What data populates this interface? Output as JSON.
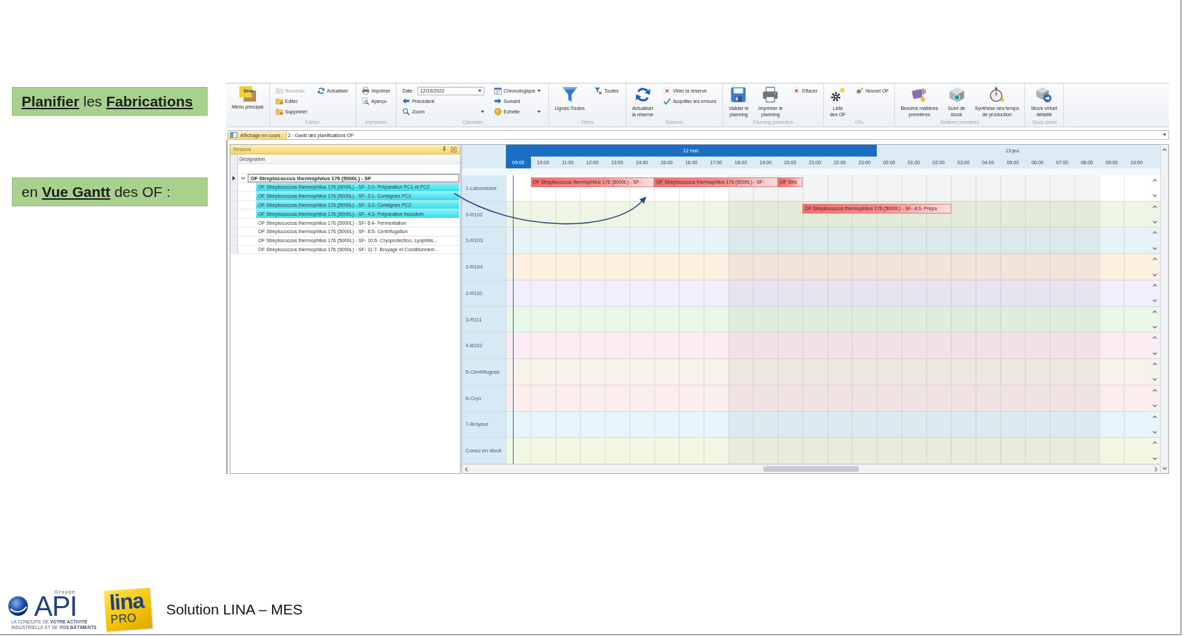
{
  "slide": {
    "headings": [
      {
        "text": "**Planifier** les **Fabrications**"
      },
      {
        "text": "en **Vue Gantt** des OF :"
      }
    ],
    "footer": {
      "api_logo": {
        "group": "Groupe",
        "name": "API",
        "tagline": "LA CONDUITE DE **VOTRE ACTIVITÉ**\nINDUSTRIELLE ET DE **VOS BÂTIMENTS**"
      },
      "lina_logo": {
        "name": "lina",
        "edition": "PRO"
      },
      "caption": "Solution LINA – MES"
    }
  },
  "app": {
    "ribbon": {
      "groups": [
        {
          "large": [
            {
              "label": "Menu principal",
              "logo_text": "lina",
              "disabled": false
            }
          ]
        },
        {
          "label": "Edition",
          "columns": [
            [
              {
                "kind": "button",
                "label": "Nouveau",
                "disabled": true
              },
              {
                "kind": "button",
                "label": "Editer",
                "disabled": false
              },
              {
                "kind": "button",
                "label": "Supprimer",
                "disabled": false
              }
            ],
            [
              {
                "kind": "button",
                "label": "Actualiser",
                "disabled": false
              }
            ]
          ]
        },
        {
          "label": "Impression",
          "columns": [
            [
              {
                "kind": "button",
                "label": "Imprimer",
                "disabled": false
              },
              {
                "kind": "button",
                "label": "Aperçu",
                "disabled": false
              }
            ]
          ]
        },
        {
          "label": "Calendrier",
          "columns": [
            [
              {
                "kind": "date",
                "label": "Date :",
                "value": "12/10/2022",
                "disabled": false
              },
              {
                "kind": "button",
                "label": "Précédent",
                "disabled": false
              },
              {
                "kind": "dropdown",
                "label": "Zoom",
                "disabled": false
              }
            ],
            [
              {
                "kind": "dropdown",
                "label": "Chronologique",
                "disabled": false
              },
              {
                "kind": "button",
                "label": "Suivant",
                "disabled": false
              },
              {
                "kind": "dropdown",
                "label": "Echelle",
                "disabled": false
              }
            ]
          ]
        },
        {
          "label": "Filtres",
          "large": [
            {
              "label": "Lignes:Toutes",
              "disabled": false
            }
          ],
          "columns": [
            [
              {
                "kind": "button",
                "label": "Toutes",
                "disabled": false
              }
            ]
          ]
        },
        {
          "label": "Réserve",
          "large": [
            {
              "label": "Actualiser\nla réserve",
              "disabled": false
            }
          ],
          "columns": [
            [
              {
                "kind": "button",
                "label": "Vider la réserve",
                "disabled": false
              },
              {
                "kind": "button",
                "label": "Acquitter les erreurs",
                "disabled": false
              }
            ]
          ]
        },
        {
          "label": "Planning production",
          "large": [
            {
              "label": "Valider le\nplanning",
              "disabled": false
            },
            {
              "label": "Imprimer le\nplanning",
              "disabled": false
            }
          ],
          "columns": [
            [
              {
                "kind": "button",
                "label": "Effacer",
                "disabled": false
              }
            ]
          ]
        },
        {
          "label": "OFs",
          "large": [
            {
              "label": "Liste\ndes OF",
              "disabled": false
            }
          ],
          "columns": [
            [
              {
                "kind": "button",
                "label": "Nouvel OF",
                "disabled": false
              }
            ]
          ]
        },
        {
          "label": "Matières premières",
          "large": [
            {
              "label": "Besoins matières\npremières",
              "disabled": false
            },
            {
              "label": "Suivi de\nstock",
              "disabled": false
            },
            {
              "label": "Synthèse des temps\nde production",
              "disabled": false
            }
          ]
        },
        {
          "label": "Stock virtuel",
          "large": [
            {
              "label": "Stock virtuel\ndétaillé",
              "disabled": false
            }
          ]
        }
      ]
    },
    "view_bar": {
      "label": "Affichage en cours :",
      "value": "2 - Gantt des planifications OF"
    },
    "reserve": {
      "title": "Réserve",
      "column": "Désignation",
      "tree": [
        {
          "label": "OF Streptococcus thermophilus 176 (5000L) - SF",
          "expanded": true,
          "focused": true,
          "children": [
            {
              "label": "OF Streptococcus thermophilus 176 (5000L) - SF- 1:0- Préparation PC1 et PC2",
              "selected": true
            },
            {
              "label": "OF Streptococcus thermophilus 176 (5000L) - SF- 2:1- Consignes PC1",
              "selected": true
            },
            {
              "label": "OF Streptococcus thermophilus 176 (5000L) - SF- 3:2- Consignes PC2",
              "selected": true
            },
            {
              "label": "OF Streptococcus thermophilus 176 (5000L) - SF- 4:3- Préparation Inoculum",
              "selected": true
            },
            {
              "label": "OF Streptococcus thermophilus 176 (5000L) - SF- 6:4- Fermentation",
              "selected": false
            },
            {
              "label": "OF Streptococcus thermophilus 176 (5000L) - SF- 8:5- Centrifugation",
              "selected": false
            },
            {
              "label": "OF Streptococcus thermophilus 176 (5000L) - SF- 10:6- Cryoprotection, Lyophilis…",
              "selected": false
            },
            {
              "label": "OF Streptococcus thermophilus 176 (5000L) - SF- 11:7- Broyage et Conditionnem…",
              "selected": false
            }
          ]
        }
      ]
    },
    "gantt": {
      "days": [
        {
          "label": "12 mer.",
          "selected": true,
          "hours": [
            {
              "label": "09:00",
              "selected": true,
              "night": false
            },
            {
              "label": "10:00",
              "selected": false,
              "night": false
            },
            {
              "label": "11:00",
              "selected": false,
              "night": false
            },
            {
              "label": "12:00",
              "selected": false,
              "night": false
            },
            {
              "label": "13:00",
              "selected": false,
              "night": false
            },
            {
              "label": "14:00",
              "selected": false,
              "night": false
            },
            {
              "label": "15:00",
              "selected": false,
              "night": false
            },
            {
              "label": "16:00",
              "selected": false,
              "night": false
            },
            {
              "label": "17:00",
              "selected": false,
              "night": false
            },
            {
              "label": "18:00",
              "selected": false,
              "night": true
            },
            {
              "label": "19:00",
              "selected": false,
              "night": true
            },
            {
              "label": "20:00",
              "selected": false,
              "night": true
            },
            {
              "label": "21:00",
              "selected": false,
              "night": true
            },
            {
              "label": "22:00",
              "selected": false,
              "night": true
            },
            {
              "label": "23:00",
              "selected": false,
              "night": true
            }
          ]
        },
        {
          "label": "13 jeu.",
          "selected": false,
          "hours": [
            {
              "label": "00:00",
              "selected": false,
              "night": true
            },
            {
              "label": "01:00",
              "selected": false,
              "night": true
            },
            {
              "label": "02:00",
              "selected": false,
              "night": true
            },
            {
              "label": "03:00",
              "selected": false,
              "night": true
            },
            {
              "label": "04:00",
              "selected": false,
              "night": true
            },
            {
              "label": "05:00",
              "selected": false,
              "night": true
            },
            {
              "label": "06:00",
              "selected": false,
              "night": true
            },
            {
              "label": "07:00",
              "selected": false,
              "night": true
            },
            {
              "label": "08:00",
              "selected": false,
              "night": true
            },
            {
              "label": "09:00",
              "selected": false,
              "night": false
            },
            {
              "label": "10:00",
              "selected": false,
              "night": false
            }
          ]
        }
      ],
      "rows": [
        {
          "label": "1-Laboratoire",
          "color": "#ffffff",
          "tasks": [
            {
              "label": "OF Streptococcus thermophilus 176 (5000L) - SF-"
            },
            {
              "label": "OF Streptococcus thermophilus 176 (5000L) - SF-"
            },
            {
              "label": "OF Stre"
            }
          ]
        },
        {
          "label": "3-R102",
          "color": "#eef6e3",
          "tasks": [
            {
              "label": "OF Streptococcus thermophilus 176 (5000L) - SF- 4:3- Prépa"
            }
          ]
        },
        {
          "label": "3-R103",
          "color": "#e7f3f6"
        },
        {
          "label": "3-R104",
          "color": "#fdefe2"
        },
        {
          "label": "3-R110",
          "color": "#f2eefb"
        },
        {
          "label": "3-R111",
          "color": "#e9f8e6"
        },
        {
          "label": "4-B102",
          "color": "#fdecf3"
        },
        {
          "label": "5-Centrifuguse",
          "color": "#f6f3ea"
        },
        {
          "label": "6-Cryo",
          "color": "#fdeeee"
        },
        {
          "label": "7-Broyeur",
          "color": "#e6f6fa"
        },
        {
          "label": "Conso en stock",
          "color": "#f2f8e4"
        }
      ]
    }
  }
}
